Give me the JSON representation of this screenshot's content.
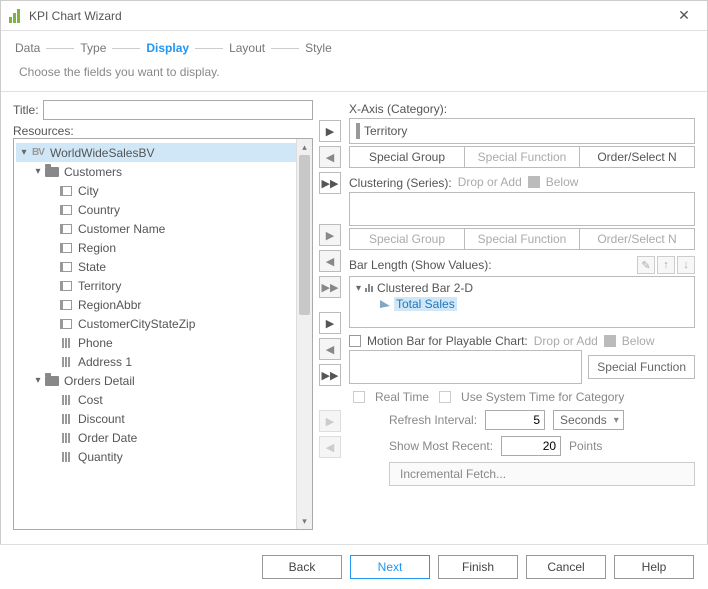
{
  "window": {
    "title": "KPI Chart Wizard"
  },
  "steps": {
    "data": "Data",
    "type": "Type",
    "display": "Display",
    "layout": "Layout",
    "style": "Style",
    "active": "Display"
  },
  "subtitle": "Choose the fields you want to display.",
  "left": {
    "title_label": "Title:",
    "title_value": "",
    "resources_label": "Resources:",
    "tree": {
      "root": "WorldWideSalesBV",
      "customers": "Customers",
      "fields": [
        "City",
        "Country",
        "Customer Name",
        "Region",
        "State",
        "Territory",
        "RegionAbbr",
        "CustomerCityStateZip",
        "Phone",
        "Address 1"
      ],
      "orders": "Orders Detail",
      "ofields": [
        "Cost",
        "Discount",
        "Order Date",
        "Quantity"
      ]
    }
  },
  "right": {
    "xaxis_label": "X-Axis (Category):",
    "xaxis_value": "Territory",
    "special_group": "Special Group",
    "special_function": "Special Function",
    "order_select": "Order/Select N",
    "clustering_label": "Clustering (Series):",
    "drop_or_add": "Drop or Add",
    "below": "Below",
    "bar_length_label": "Bar Length (Show Values):",
    "bar_node": "Clustered Bar 2-D",
    "bar_value": "Total Sales",
    "motion_label": "Motion Bar for Playable Chart:",
    "real_time": "Real Time",
    "use_system": "Use System Time for Category",
    "refresh_label": "Refresh Interval:",
    "refresh_value": "5",
    "refresh_unit": "Seconds",
    "recent_label": "Show Most Recent:",
    "recent_value": "20",
    "recent_unit": "Points",
    "incremental": "Incremental Fetch..."
  },
  "footer": {
    "back": "Back",
    "next": "Next",
    "finish": "Finish",
    "cancel": "Cancel",
    "help": "Help"
  }
}
